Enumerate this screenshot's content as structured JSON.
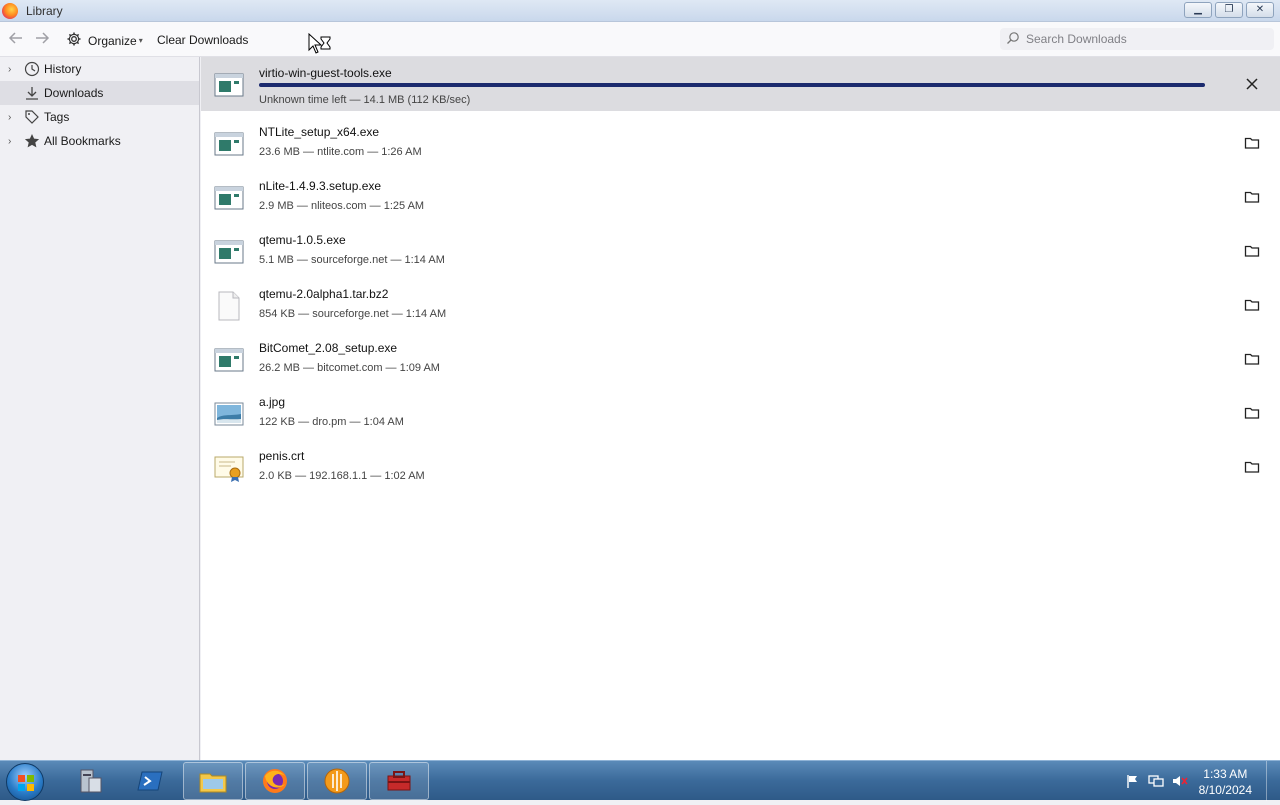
{
  "window": {
    "title": "Library"
  },
  "toolbar": {
    "organize_label": "Organize",
    "clear_label": "Clear Downloads",
    "search_placeholder": "Search Downloads"
  },
  "sidebar": {
    "items": [
      {
        "label": "History",
        "icon": "clock-icon",
        "expandable": true
      },
      {
        "label": "Downloads",
        "icon": "download-icon",
        "expandable": false,
        "selected": true
      },
      {
        "label": "Tags",
        "icon": "tag-icon",
        "expandable": true
      },
      {
        "label": "All Bookmarks",
        "icon": "star-icon",
        "expandable": true
      }
    ]
  },
  "downloads": [
    {
      "name": "virtio-win-guest-tools.exe",
      "status": "Unknown time left — 14.1 MB (112 KB/sec)",
      "icon": "exe-icon",
      "active": true
    },
    {
      "name": "NTLite_setup_x64.exe",
      "status": "23.6 MB — ntlite.com — 1:26 AM",
      "icon": "exe-icon"
    },
    {
      "name": "nLite-1.4.9.3.setup.exe",
      "status": "2.9 MB — nliteos.com — 1:25 AM",
      "icon": "exe-icon"
    },
    {
      "name": "qtemu-1.0.5.exe",
      "status": "5.1 MB — sourceforge.net — 1:14 AM",
      "icon": "exe-icon"
    },
    {
      "name": "qtemu-2.0alpha1.tar.bz2",
      "status": "854 KB — sourceforge.net — 1:14 AM",
      "icon": "file-icon"
    },
    {
      "name": "BitComet_2.08_setup.exe",
      "status": "26.2 MB — bitcomet.com — 1:09 AM",
      "icon": "exe-icon"
    },
    {
      "name": "a.jpg",
      "status": "122 KB — dro.pm — 1:04 AM",
      "icon": "image-icon"
    },
    {
      "name": "penis.crt",
      "status": "2.0 KB — 192.168.1.1 — 1:02 AM",
      "icon": "certificate-icon"
    }
  ],
  "taskbar": {
    "time": "1:33 AM",
    "date": "8/10/2024"
  }
}
